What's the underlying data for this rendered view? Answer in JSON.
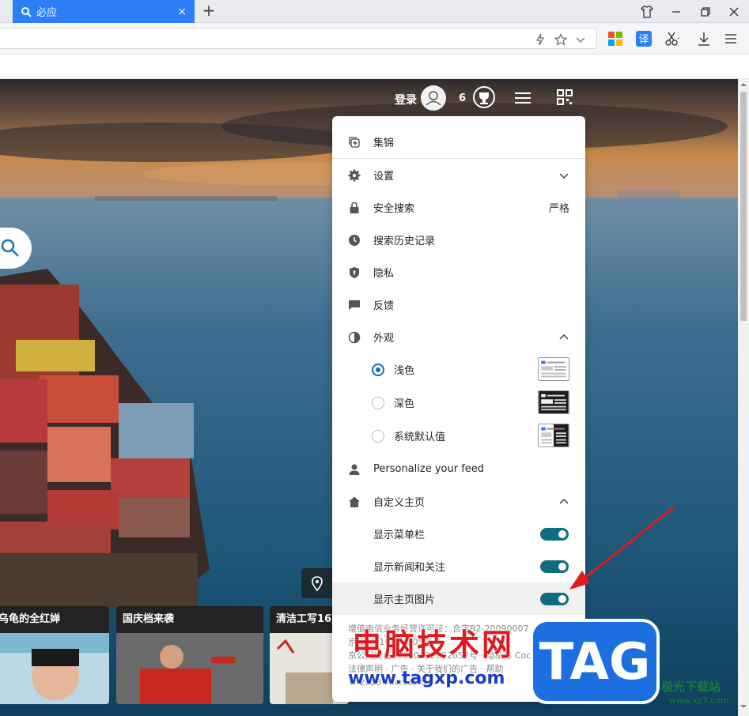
{
  "browser": {
    "tab_title": "必应",
    "tab_close": "×",
    "new_tab": "+"
  },
  "header": {
    "login_label": "登录",
    "reward_count": "6"
  },
  "news_cards": [
    {
      "title": "乌龟的全红婵"
    },
    {
      "title": "国庆档来袭"
    },
    {
      "title": "清洁工写16万"
    }
  ],
  "menu": {
    "collections": "集锦",
    "settings": "设置",
    "safe_search": "安全搜索",
    "safe_search_value": "严格",
    "search_history": "搜索历史记录",
    "privacy": "隐私",
    "feedback": "反馈",
    "appearance": "外观",
    "appearance_options": [
      {
        "label": "浅色",
        "selected": true
      },
      {
        "label": "深色",
        "selected": false
      },
      {
        "label": "系统默认值",
        "selected": false
      }
    ],
    "personalize_feed": "Personalize your feed",
    "customize_home": "自定义主页",
    "home_options": [
      {
        "label": "显示菜单栏",
        "enabled": true
      },
      {
        "label": "显示新闻和关注",
        "enabled": true
      },
      {
        "label": "显示主页图片",
        "enabled": true
      }
    ]
  },
  "footer": {
    "line1": "增值电信业务经营许可证：合字B2-20090007",
    "line2": "京ICP备10036305号-7",
    "line3": "京公网安备11010802022657号 · 隐私与 Cookie ·",
    "line4": "法律声明 · 广告 · 关于我们的广告 · 帮助",
    "line5": "© 2023 Microsoft"
  },
  "watermark": {
    "brand": "电脑技术网",
    "url": "www.tagxp.com",
    "tag": "TAG",
    "corner": "极光下载站",
    "corner_url": "www.xz7.com"
  },
  "colors": {
    "tab_blue": "#2b7ef5",
    "toggle_teal": "#0f6c81",
    "radio_blue": "#0f6cbd",
    "arrow_red": "#e0191e"
  }
}
